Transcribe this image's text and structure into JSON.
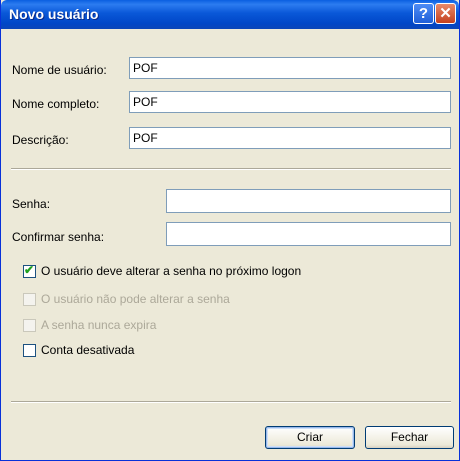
{
  "window": {
    "title": "Novo usuário",
    "help_glyph": "?",
    "close_glyph": "✕"
  },
  "form": {
    "username_label": "Nome de usuário:",
    "username_value": "POF",
    "fullname_label": "Nome completo:",
    "fullname_value": "POF",
    "description_label": "Descrição:",
    "description_value": "POF",
    "password_label": "Senha:",
    "password_value": "",
    "confirm_label": "Confirmar senha:",
    "confirm_value": ""
  },
  "options": {
    "must_change": {
      "label": "O usuário deve alterar a senha no próximo logon",
      "checked": true
    },
    "cannot_change": {
      "label": "O usuário não pode alterar a senha",
      "disabled": true
    },
    "never_expires": {
      "label": "A senha nunca expira",
      "disabled": true
    },
    "disabled_account": {
      "label": "Conta desativada",
      "checked": false
    }
  },
  "buttons": {
    "create": "Criar",
    "close": "Fechar"
  },
  "colors": {
    "titlebar": "#0a58d8",
    "window_bg": "#ece9d8",
    "field_border": "#7f9db9",
    "check": "#21a121"
  }
}
